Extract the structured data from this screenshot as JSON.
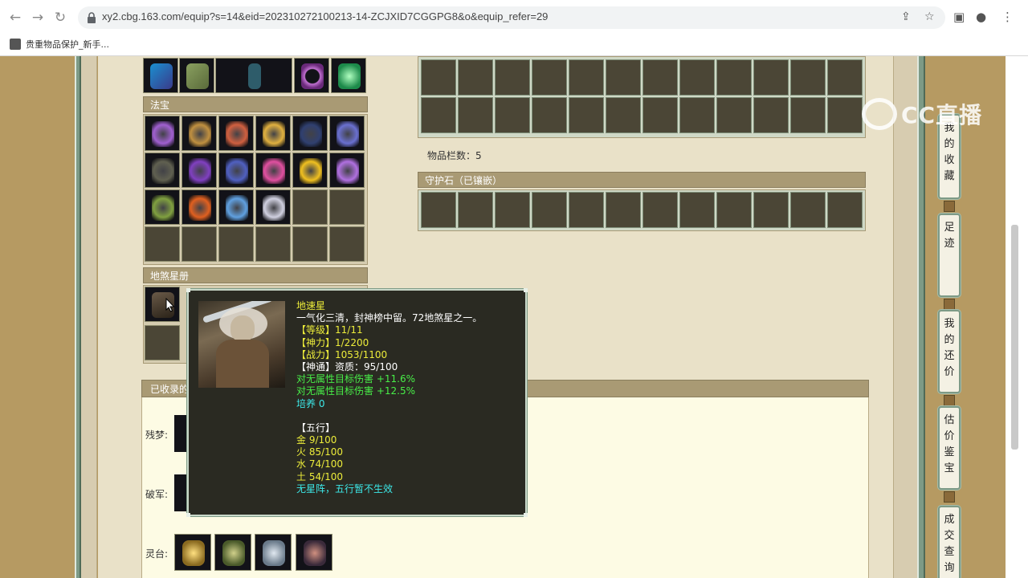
{
  "browser": {
    "url": "xy2.cbg.163.com/equip?s=14&eid=202310272100213-14-ZCJXID7CGGPG8&o&equip_refer=29",
    "bookmark": "贵重物品保护_新手..."
  },
  "watermark": "CC直播",
  "sections": {
    "fabao_title": "法宝",
    "dishaxingce_title": "地煞星册",
    "item_count_label": "物品栏数：5",
    "guardian_stone_title": "守护石（已镶嵌）",
    "collected_title": "已收录的"
  },
  "lower": {
    "row1_label": "残梦:",
    "row2_label": "破军:",
    "row3_label": "灵台:"
  },
  "side_tabs": [
    {
      "label": [
        "我",
        "的",
        "收",
        "藏"
      ]
    },
    {
      "label": [
        "足",
        "迹"
      ]
    },
    {
      "label": [
        "我",
        "的",
        "还",
        "价"
      ]
    },
    {
      "label": [
        "估",
        "价",
        "鉴",
        "宝"
      ]
    },
    {
      "label": [
        "成",
        "交",
        "查",
        "询"
      ]
    }
  ],
  "tooltip": {
    "name": "地速星",
    "desc": "一气化三清，封神榜中留。72地煞星之一。",
    "level": "【等级】11/11",
    "shenli": "【神力】1/2200",
    "zhanli": "【战力】1053/1100",
    "shentong": "【神通】资质：95/100",
    "stat1": "对无属性目标伤害 +11.6%",
    "stat2": "对无属性目标伤害 +12.5%",
    "peiyang": "培养 0",
    "wuxing_title": "【五行】",
    "jin": "金 9/100",
    "huo": "火 85/100",
    "shui": "水 74/100",
    "tu": "土 54/100",
    "note": "无星阵，五行暂不生效"
  },
  "colors": {
    "tooltip_yellow": "#ecec3a",
    "tooltip_green": "#48ee48",
    "tooltip_cyan": "#3ce8e8",
    "panel_header": "#a99a74",
    "frame_green": "#7d9a86"
  },
  "icons": {
    "top_row": [
      "staff-icon",
      "boots-icon",
      "character-figure",
      "bracelet-icon",
      "orb-icon"
    ],
    "fabao": [
      "purple-lantern-icon",
      "golden-token-icon",
      "pipa-icon",
      "pagoda-lantern-icon",
      "dark-orb-icon",
      "claw-gauntlet-icon",
      "stone-tablet-icon",
      "purple-whip-icon",
      "scroll-icon",
      "pink-lantern-icon",
      "golden-flower-icon",
      "purple-fan-icon",
      "jade-seal-icon",
      "red-crystal-icon",
      "ice-sword-icon",
      "white-mirror-icon"
    ],
    "lingtai": [
      "golden-crown-icon",
      "jade-mask-icon",
      "silver-cloak-icon",
      "dark-bottle-icon"
    ]
  }
}
